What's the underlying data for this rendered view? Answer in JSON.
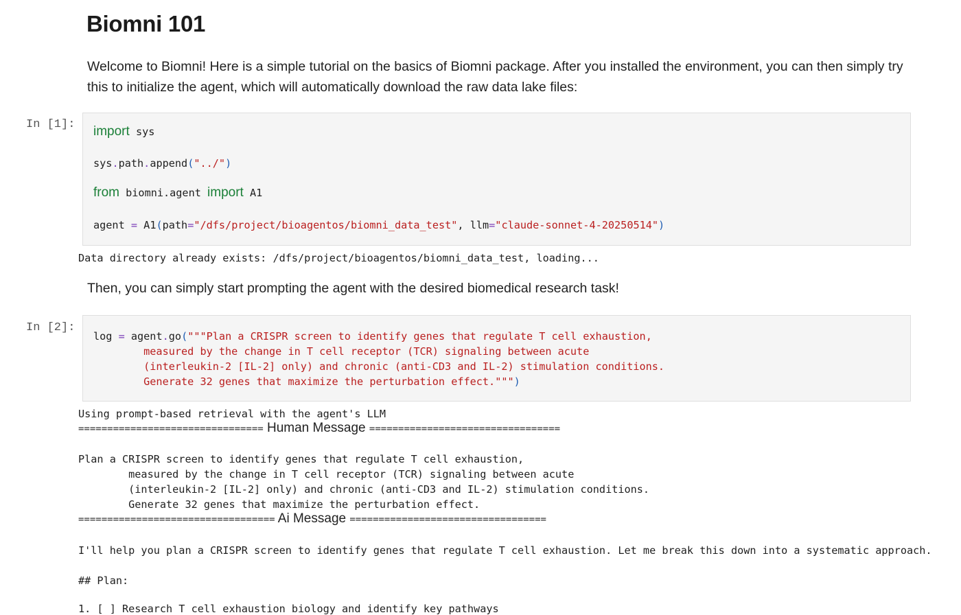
{
  "notebook": {
    "title": "Biomni 101",
    "intro": "Welcome to Biomni! Here is a simple tutorial on the basics of Biomni package. After you installed the environment, you can then simply try this to initialize the agent, which will automatically download the raw data lake files:",
    "then_text": "Then, you can simply start prompting the agent with the desired biomedical research task!"
  },
  "cell1": {
    "prompt": "In [1]:",
    "kw_import": "import",
    "mod_sys": " sys",
    "line2_obj": "sys",
    "line2_dot": ".",
    "line2_fn": "path",
    "line2_dot2": ".",
    "line2_call": "append",
    "line2_open": "(",
    "line2_arg": "\"../\"",
    "line2_close": ")",
    "kw_from": "from",
    "mod_agent": " biomni.agent ",
    "kw_import2": "import",
    "cls_a1": " A1",
    "l4_var": "agent ",
    "l4_eq": "=",
    "l4_cls": " A1",
    "l4_open": "(",
    "l4_p1": "path",
    "l4_eq1": "=",
    "l4_v1": "\"/dfs/project/bioagentos/biomni_data_test\"",
    "l4_comma": ", ",
    "l4_p2": "llm",
    "l4_eq2": "=",
    "l4_v2": "\"claude-sonnet-4-20250514\"",
    "l4_close": ")",
    "output": "Data directory already exists: /dfs/project/bioagentos/biomni_data_test, loading..."
  },
  "cell2": {
    "prompt": "In [2]:",
    "l1_var": "log ",
    "l1_eq": "=",
    "l1_obj": " agent",
    "l1_dot": ".",
    "l1_fn": "go",
    "l1_open": "(",
    "l1_str": "\"\"\"Plan a CRISPR screen to identify genes that regulate T cell exhaustion,",
    "l2_str": "        measured by the change in T cell receptor (TCR) signaling between acute",
    "l3_str": "        (interleukin-2 [IL-2] only) and chronic (anti-CD3 and IL-2) stimulation conditions.",
    "l4_str": "        Generate 32 genes that maximize the perturbation effect.\"\"\"",
    "l4_close": ")"
  },
  "output2": {
    "line1": "Using prompt-based retrieval with the agent's LLM",
    "sep1_left": "================================",
    "human_label": " Human Message ",
    "sep1_right": "=================================",
    "p1": "Plan a CRISPR screen to identify genes that regulate T cell exhaustion,",
    "p2": "        measured by the change in T cell receptor (TCR) signaling between acute",
    "p3": "        (interleukin-2 [IL-2] only) and chronic (anti-CD3 and IL-2) stimulation conditions.",
    "p4": "        Generate 32 genes that maximize the perturbation effect.",
    "sep2_left": "==================================",
    "ai_label": " Ai Message ",
    "sep2_right": "==================================",
    "ai1": "I'll help you plan a CRISPR screen to identify genes that regulate T cell exhaustion. Let me break this down into a systematic approach.",
    "ai2": "## Plan:",
    "ai3": "1. [ ] Research T cell exhaustion biology and identify key pathways"
  }
}
